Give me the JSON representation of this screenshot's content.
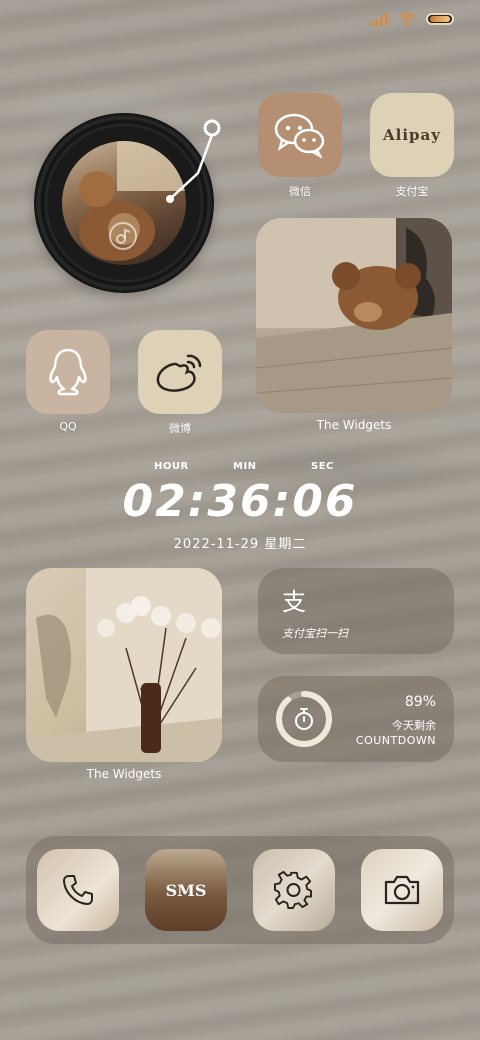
{
  "status_bar": {
    "signal": "signal-icon",
    "wifi": "wifi-icon",
    "battery": "battery-icon"
  },
  "apps": {
    "wechat": {
      "label": "微信",
      "icon": "wechat-icon"
    },
    "alipay": {
      "label": "支付宝",
      "icon_text": "Alipay"
    },
    "qq": {
      "label": "QQ",
      "icon": "qq-penguin-icon"
    },
    "weibo": {
      "label": "微博",
      "icon": "weibo-icon"
    }
  },
  "widgets": {
    "photo_top_caption": "The Widgets",
    "photo_bottom_caption": "The Widgets",
    "alipay_scan": {
      "icon_text": "支",
      "label": "支付宝扫一扫"
    },
    "countdown": {
      "percent": "89%",
      "label_cn": "今天剩余",
      "label_en": "COUNTDOWN",
      "progress": 0.89
    }
  },
  "clock": {
    "hour_label": "HOUR",
    "min_label": "MIN",
    "sec_label": "SEC",
    "time": "02:36:06",
    "date": "2022-11-29  星期二"
  },
  "dock": {
    "phone": "phone-icon",
    "sms_text": "SMS",
    "settings": "gear-icon",
    "camera": "camera-icon"
  },
  "colors": {
    "accent": "#c98035",
    "icon_brown": "#b9957a",
    "icon_cream": "#ddd1b6"
  }
}
